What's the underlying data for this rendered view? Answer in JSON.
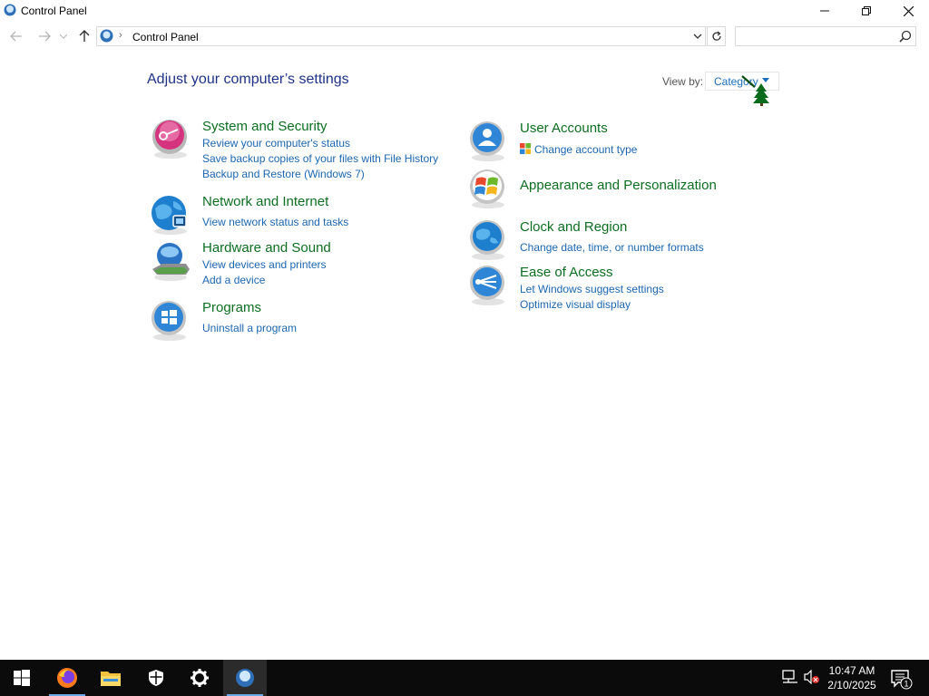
{
  "window": {
    "title": "Control Panel",
    "controls": {
      "minimize": "minimize",
      "maximize": "restore",
      "close": "close"
    }
  },
  "address": {
    "breadcrumb": "Control Panel",
    "search_placeholder": ""
  },
  "heading": "Adjust your computer’s settings",
  "view_by": {
    "label": "View by:",
    "value": "Category"
  },
  "categories_left": [
    {
      "title": "System and Security",
      "icon": "shield-key-icon",
      "links": [
        "Review your computer's status",
        "Save backup copies of your files with File History",
        "Backup and Restore (Windows 7)"
      ]
    },
    {
      "title": "Network and Internet",
      "icon": "globe-network-icon",
      "links": [
        "View network status and tasks"
      ]
    },
    {
      "title": "Hardware and Sound",
      "icon": "printer-speaker-icon",
      "links": [
        "View devices and printers",
        "Add a device"
      ]
    },
    {
      "title": "Programs",
      "icon": "programs-icon",
      "links": [
        "Uninstall a program"
      ]
    }
  ],
  "categories_right": [
    {
      "title": "User Accounts",
      "icon": "user-accounts-icon",
      "links": [
        "Change account type"
      ]
    },
    {
      "title": "Appearance and Personalization",
      "icon": "appearance-icon",
      "links": []
    },
    {
      "title": "Clock and Region",
      "icon": "clock-globe-icon",
      "links": [
        "Change date, time, or number formats"
      ]
    },
    {
      "title": "Ease of Access",
      "icon": "ease-of-access-icon",
      "links": [
        "Let Windows suggest settings",
        "Optimize visual display"
      ]
    }
  ],
  "taskbar": {
    "apps": [
      "start-icon",
      "firefox-icon",
      "file-explorer-icon",
      "security-icon",
      "settings-icon",
      "control-panel-icon"
    ],
    "time": "10:47 AM",
    "date": "2/10/2025",
    "notification_count": "1"
  },
  "colors": {
    "heading": "#1e3287",
    "category_title": "#0d6e21",
    "link": "#1c66b0",
    "taskbar": "#0b0b0b"
  }
}
